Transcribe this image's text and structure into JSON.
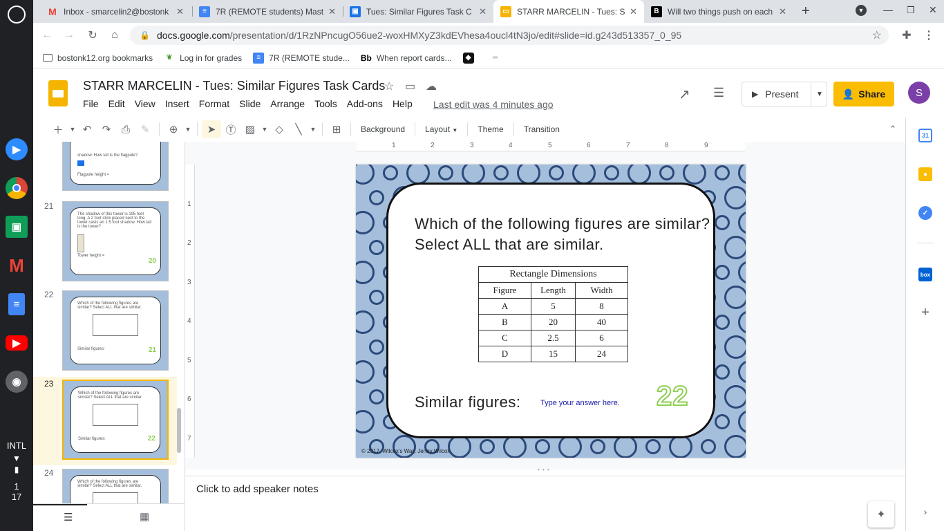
{
  "shelf": {
    "ime": "INTL",
    "time_hour": "1",
    "time_min": "17"
  },
  "tabs": [
    {
      "title": "Inbox - smarcelin2@bostonk",
      "icon": "gmail-icon"
    },
    {
      "title": "7R (REMOTE students) Mast",
      "icon": "docs-icon"
    },
    {
      "title": "Tues: Similar Figures Task C",
      "icon": "classroom-icon"
    },
    {
      "title": "STARR MARCELIN - Tues: Sim",
      "icon": "slides-icon"
    },
    {
      "title": "Will two things push on each",
      "icon": "bb-icon"
    }
  ],
  "omnibox": {
    "host": "docs.google.com",
    "path": "/presentation/d/1RzNPncugO56ue2-woxHMXyZ3kdEVhesa4oucl4tN3jo/edit#slide=id.g243d513357_0_95"
  },
  "bookmarks": [
    {
      "label": "bostonk12.org bookmarks",
      "icon": "folder-icon"
    },
    {
      "label": "Log in for grades",
      "icon": "leaf-icon"
    },
    {
      "label": "7R (REMOTE stude...",
      "icon": "docs-icon"
    },
    {
      "label": "When report cards...",
      "icon": "bb-icon"
    }
  ],
  "header": {
    "title": "STARR MARCELIN - Tues: Similar Figures Task Cards",
    "menus": [
      "File",
      "Edit",
      "View",
      "Insert",
      "Format",
      "Slide",
      "Arrange",
      "Tools",
      "Add-ons",
      "Help"
    ],
    "last_edit": "Last edit was 4 minutes ago",
    "present": "Present",
    "share": "Share",
    "avatar": "S"
  },
  "edit_toolbar": {
    "background": "Background",
    "layout": "Layout",
    "theme": "Theme",
    "transition": "Transition"
  },
  "filmstrip": {
    "slides": [
      {
        "num": "21",
        "text": "The shadow of this tower is 195 feet long. A 2 foot stick placed next to the tower casts an 1.5 foot shadow. How tall is the tower?",
        "footer": "Tower height =",
        "card": "20"
      },
      {
        "num": "22",
        "text": "Which of the following figures are similar? Select ALL that are similar.",
        "footer": "Similar figures:",
        "card": "21"
      },
      {
        "num": "23",
        "text": "Which of the following figures are similar? Select ALL that are similar.",
        "footer": "Similar figures:",
        "card": "22"
      },
      {
        "num": "24",
        "text": "Which of the following figures are similar? Select ALL that are similar.",
        "footer": "",
        "card": ""
      }
    ],
    "partial_top_text": "shadow. How tall is the flagpole?",
    "partial_top_footer": "Flagpole height ="
  },
  "ruler": {
    "h": [
      "1",
      "2",
      "3",
      "4",
      "5",
      "6",
      "7",
      "8",
      "9"
    ],
    "v": [
      "1",
      "2",
      "3",
      "4",
      "5",
      "6",
      "7"
    ]
  },
  "slide": {
    "question": "Which of the following figures are similar? Select ALL that are similar.",
    "table": {
      "caption": "Rectangle Dimensions",
      "headers": [
        "Figure",
        "Length",
        "Width"
      ],
      "rows": [
        [
          "A",
          "5",
          "8"
        ],
        [
          "B",
          "20",
          "40"
        ],
        [
          "C",
          "2.5",
          "6"
        ],
        [
          "D",
          "15",
          "24"
        ]
      ]
    },
    "answer_label": "Similar figures:",
    "answer_value": "Type your answer here.",
    "card_number": "22",
    "copyright": "© 2017, Wilcox's Way, Jenny Wilcox"
  },
  "notes": {
    "placeholder": "Click to add speaker notes"
  }
}
